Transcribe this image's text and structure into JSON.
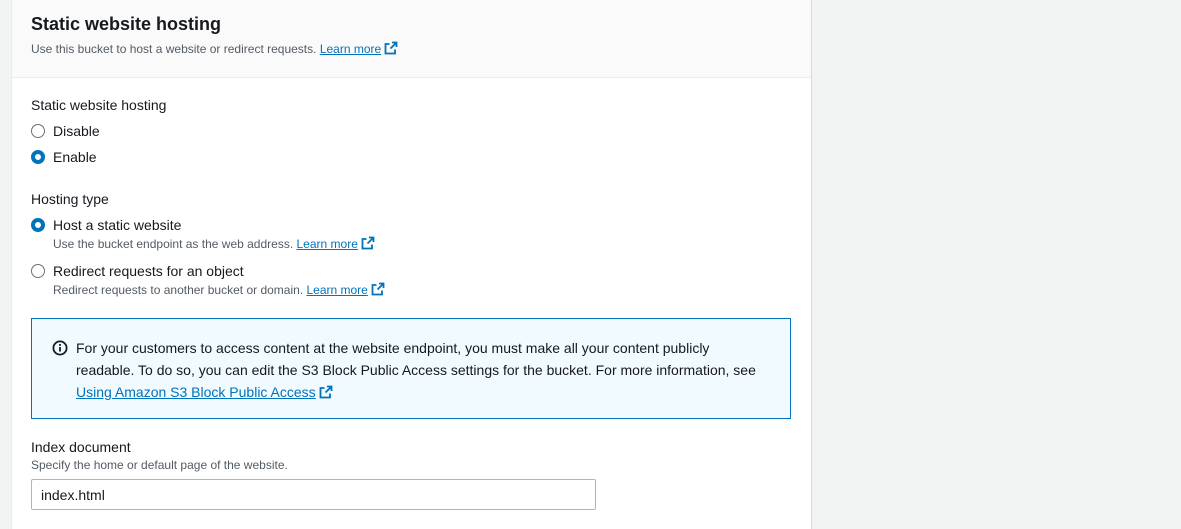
{
  "section": {
    "title": "Static website hosting",
    "description": "Use this bucket to host a website or redirect requests.",
    "learn_more": "Learn more"
  },
  "static_hosting": {
    "label": "Static website hosting",
    "options": [
      {
        "label": "Disable",
        "checked": false
      },
      {
        "label": "Enable",
        "checked": true
      }
    ]
  },
  "hosting_type": {
    "label": "Hosting type",
    "options": [
      {
        "label": "Host a static website",
        "description": "Use the bucket endpoint as the web address.",
        "learn_more": "Learn more",
        "checked": true
      },
      {
        "label": "Redirect requests for an object",
        "description": "Redirect requests to another bucket or domain.",
        "learn_more": "Learn more",
        "checked": false
      }
    ]
  },
  "info": {
    "text": "For your customers to access content at the website endpoint, you must make all your content publicly readable. To do so, you can edit the S3 Block Public Access settings for the bucket. For more information, see",
    "link": "Using Amazon S3 Block Public Access"
  },
  "index_document": {
    "label": "Index document",
    "description": "Specify the home or default page of the website.",
    "value": "index.html"
  },
  "colors": {
    "accent": "#0073bb",
    "info_bg": "#f1faff",
    "page_bg": "#f2f3f3"
  }
}
